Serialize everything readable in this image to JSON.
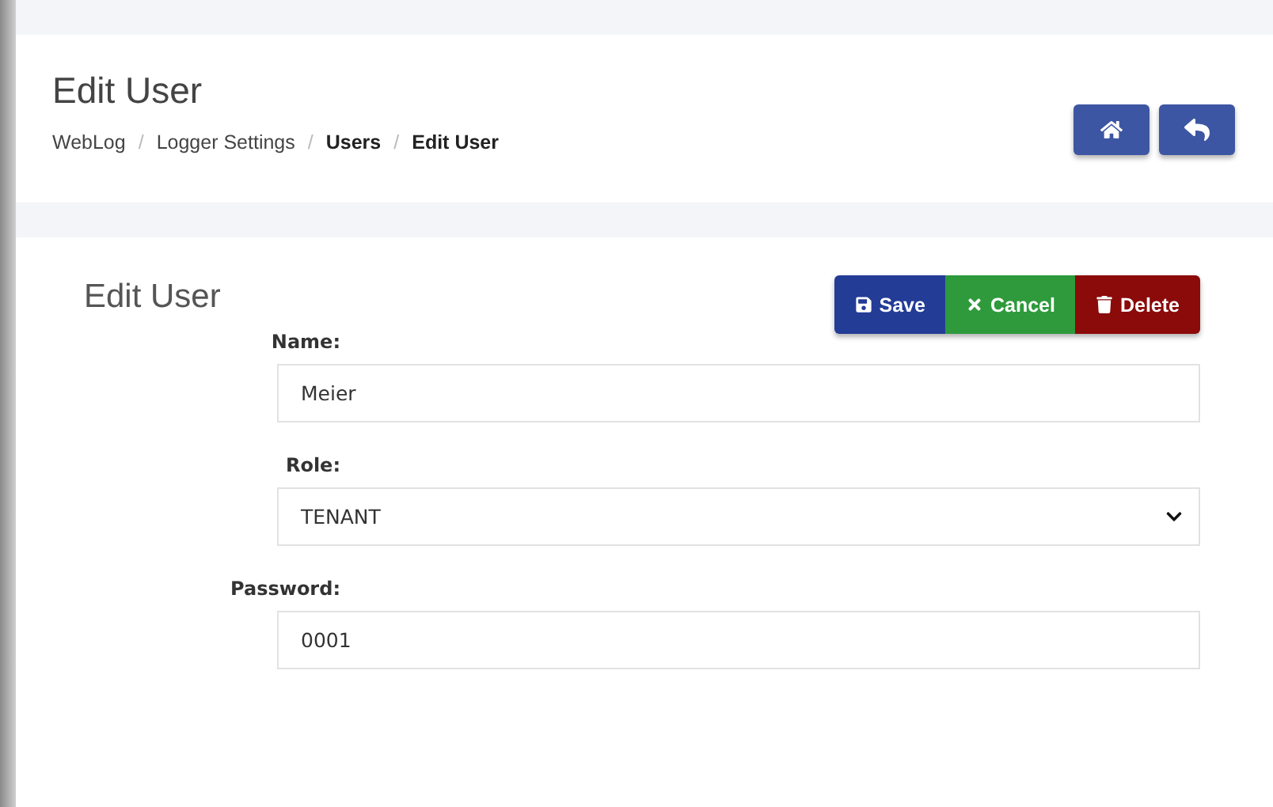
{
  "header": {
    "title": "Edit User",
    "separator": "/",
    "breadcrumbs": [
      {
        "label": "WebLog",
        "bold": false
      },
      {
        "label": "Logger Settings",
        "bold": false
      },
      {
        "label": "Users",
        "bold": true
      },
      {
        "label": "Edit User",
        "bold": true
      }
    ],
    "nav_buttons": [
      {
        "kind": "home"
      },
      {
        "kind": "back"
      }
    ]
  },
  "card": {
    "title": "Edit User",
    "actions": [
      {
        "kind": "save",
        "label": "Save"
      },
      {
        "kind": "cancel",
        "label": "Cancel"
      },
      {
        "kind": "delete",
        "label": "Delete"
      }
    ],
    "fields": [
      {
        "kind": "input",
        "label": "Name:",
        "value": "Meier"
      },
      {
        "kind": "select",
        "label": "Role:",
        "value": "TENANT"
      },
      {
        "kind": "input",
        "label": "Password:",
        "value": "0001"
      }
    ]
  }
}
